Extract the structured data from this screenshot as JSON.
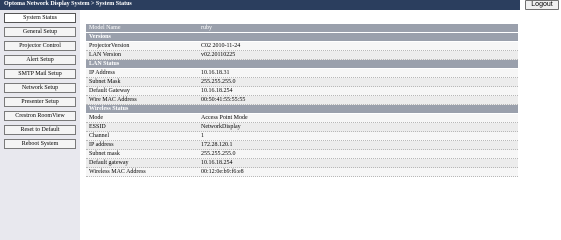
{
  "header": {
    "title": "Optoma Network Display System > System Status",
    "logout_label": "Logout"
  },
  "sidebar": {
    "items": [
      {
        "label": "System Status"
      },
      {
        "label": "General Setup"
      },
      {
        "label": "Projector Control"
      },
      {
        "label": "Alert Setup"
      },
      {
        "label": "SMTP Mail Setup"
      },
      {
        "label": "Network Setup"
      },
      {
        "label": "Presenter Setup"
      },
      {
        "label": "Crestron RoomView"
      },
      {
        "label": "Reset to Default"
      },
      {
        "label": "Reboot System"
      }
    ]
  },
  "status": {
    "model_label": "Model Name",
    "model_value": "ruby",
    "versions_title": "Versions",
    "projector_version_label": "ProjectorVersion",
    "projector_version_value": "C02 2010-11-24",
    "lan_version_label": "LAN Version",
    "lan_version_value": "v02.20110225",
    "lan_title": "LAN Status",
    "ip_label": "IP Address",
    "ip_value": "10.16.18.31",
    "subnet_label": "Subnet Mask",
    "subnet_value": "255.255.255.0",
    "gateway_label": "Default Gateway",
    "gateway_value": "10.16.18.254",
    "wire_mac_label": "Wire MAC Address",
    "wire_mac_value": "00:50:41:55:55:55",
    "wireless_title": "Wireless Status",
    "mode_label": "Mode",
    "mode_value": "Access Point Mode",
    "essid_label": "ESSID",
    "essid_value": "NetworkDisplay",
    "channel_label": "Channel",
    "channel_value": "1",
    "wl_ip_label": "IP address",
    "wl_ip_value": "172.28.120.1",
    "wl_subnet_label": "Subnet mask",
    "wl_subnet_value": "255.255.255.0",
    "wl_gateway_label": "Default gateway",
    "wl_gateway_value": "10.16.18.254",
    "wl_mac_label": "Wireless MAC Address",
    "wl_mac_value": "00:12:0e:b9:f6:e8"
  },
  "colors": {
    "topbar": "#2b3e5e",
    "section_header": "#9aa0ac",
    "sidebar": "#e8e8ee"
  }
}
